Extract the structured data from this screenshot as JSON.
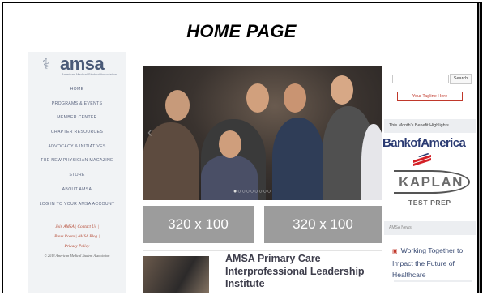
{
  "page_title": "HOME PAGE",
  "logo": {
    "word": "amsa",
    "tagline": "American Medical Student Association"
  },
  "nav": [
    "HOME",
    "PROGRAMS & EVENTS",
    "MEMBER CENTER",
    "CHAPTER RESOURCES",
    "ADVOCACY & INITIATIVES",
    "THE NEW PHYSICIAN MAGAZINE",
    "STORE",
    "ABOUT AMSA",
    "LOG IN TO YOUR AMSA ACCOUNT"
  ],
  "footer_links": {
    "line1": "Join AMSA  |  Contact Us  |",
    "line2": "Press Room  |  AMSA Blog  |",
    "line3": "Privacy Policy",
    "copyright": "© 2013 American Medical Student Association"
  },
  "hero": {
    "dots": "●○○○○○○○○"
  },
  "ads": [
    "320 x 100",
    "320 x 100"
  ],
  "article": {
    "headline": "AMSA Primary Care Interprofessional Leadership Institute"
  },
  "search": {
    "button": "Search"
  },
  "tagline": "Your Tagline Here",
  "benefits": {
    "heading": "This Month's Benefit Highlights",
    "sponsor1": "BankofAmerica",
    "sponsor2": "KAPLAN",
    "sponsor2_sub": "TEST PREP"
  },
  "news": {
    "heading": "AMSA News",
    "item": "Working Together to Impact the Future of Healthcare"
  },
  "colors": {
    "accent_red": "#c0382b",
    "nav_text": "#5c6680",
    "ad_gray": "#9c9c9c"
  }
}
